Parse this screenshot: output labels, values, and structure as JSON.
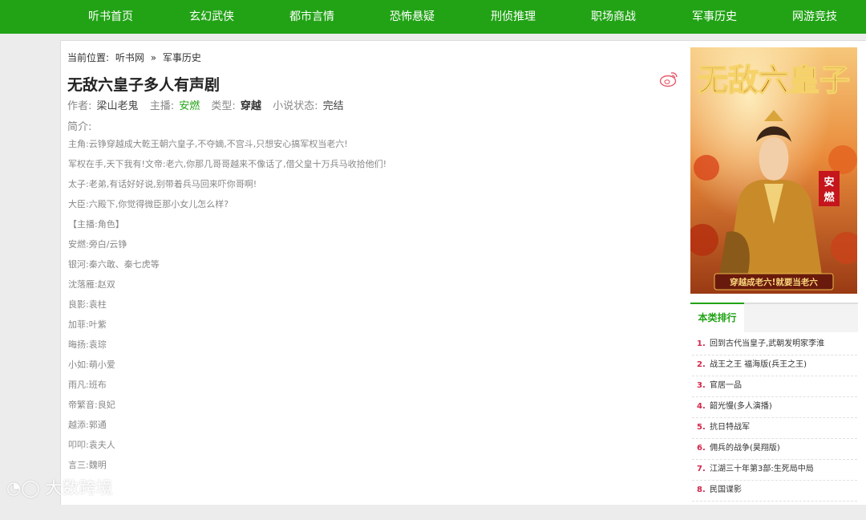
{
  "nav": [
    "听书首页",
    "玄幻武侠",
    "都市言情",
    "恐怖悬疑",
    "刑侦推理",
    "职场商战",
    "军事历史",
    "网游竞技"
  ],
  "breadcrumb": {
    "label": "当前位置:",
    "site": "听书网",
    "sep": "»",
    "category": "军事历史"
  },
  "book": {
    "title": "无敌六皇子多人有声剧",
    "author_label": "作者:",
    "author": "梁山老鬼",
    "host_label": "主播:",
    "host": "安燃",
    "type_label": "类型:",
    "type": "穿越",
    "status_label": "小说状态:",
    "status": "完结",
    "intro_label": "简介:",
    "intro_lines": [
      "主角:云铮穿越成大乾王朝六皇子,不夺嫡,不宫斗,只想安心搞军权当老六!",
      "军权在手,天下我有!文帝:老六,你那几哥哥越来不像话了,借父皇十万兵马收拾他们!",
      "太子:老弟,有话好好说,别带着兵马回来吓你哥啊!",
      "大臣:六殿下,你觉得微臣那小女儿怎么样?",
      "【主播:角色】",
      "安燃:旁白/云铮",
      "银河:秦六敢、秦七虎等",
      "沈落雁:赵双",
      "良影:袁柱",
      "加菲:叶紫",
      "晦扬:袁琮",
      "小如:萌小爱",
      "雨凡:班布",
      "帝繁音:良妃",
      "越添:郭通",
      "叩叩:袁夫人",
      "言三:魏明",
      "",
      ""
    ]
  },
  "cover": {
    "title_art": "无敌六皇子",
    "host_seal": "安燃",
    "slogan": "穿越成老六!就要当老六"
  },
  "ranking": {
    "title": "本类排行",
    "items": [
      "回到古代当皇子,武朝发明家李淮",
      "战王之王 福海版(兵王之王)",
      "官居一品",
      "韶光慢(多人演播)",
      "抗日特战军",
      "佣兵的战争(昊翔版)",
      "江湖三十年第3部:生死局中局",
      "民国谍影"
    ]
  },
  "watermark": "大数跨境",
  "colors": {
    "brand_green": "#22a316",
    "rank_red": "#d3264a"
  }
}
